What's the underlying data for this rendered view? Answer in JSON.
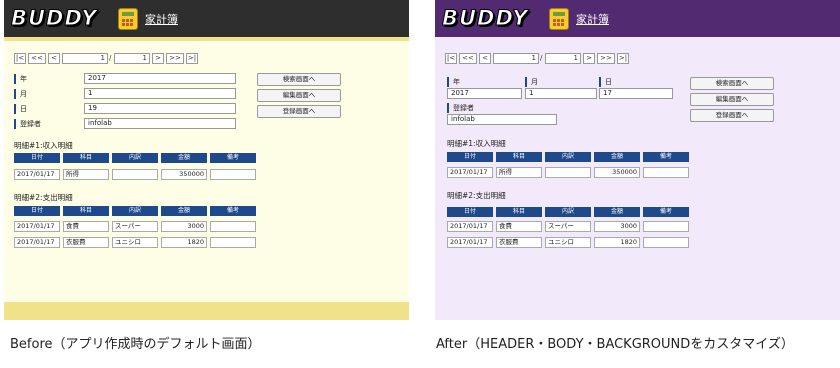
{
  "before": {
    "logo": "BUDDY",
    "app_title": "家計簿",
    "pager": {
      "first": "|<",
      "prev10": "<<",
      "prev": "<",
      "current": "1",
      "sep": "/",
      "total": "1",
      "next": ">",
      "next10": ">>",
      "last": ">|"
    },
    "fields": {
      "year_label": "年",
      "year_value": "2017",
      "month_label": "月",
      "month_value": "1",
      "day_label": "日",
      "day_value": "19",
      "registrant_label": "登録者",
      "registrant_value": "infolab"
    },
    "nav_buttons": [
      "検索画面へ",
      "編集画面へ",
      "登録画面へ"
    ],
    "section1": {
      "title": "明細#1:収入明細",
      "headers": [
        "日付",
        "科目",
        "内訳",
        "金額",
        "備考"
      ],
      "rows": [
        [
          "2017/01/17",
          "所得",
          "",
          "350000",
          ""
        ]
      ]
    },
    "section2": {
      "title": "明細#2:支出明細",
      "headers": [
        "日付",
        "科目",
        "内訳",
        "金額",
        "備考"
      ],
      "rows": [
        [
          "2017/01/17",
          "食費",
          "スーパー",
          "3000",
          ""
        ],
        [
          "2017/01/17",
          "衣服費",
          "ユニシロ",
          "1820",
          ""
        ]
      ]
    },
    "caption": "Before（アプリ作成時のデフォルト画面）"
  },
  "after": {
    "logo": "BUDDY",
    "app_title": "家計簿",
    "pager": {
      "first": "|<",
      "prev10": "<<",
      "prev": "<",
      "current": "1",
      "sep": "/",
      "total": "1",
      "next": ">",
      "next10": ">>",
      "last": ">|"
    },
    "fields": {
      "year_label": "年",
      "year_value": "2017",
      "month_label": "月",
      "month_value": "1",
      "day_label": "日",
      "day_value": "17",
      "registrant_label": "登録者",
      "registrant_value": "infolab"
    },
    "nav_buttons": [
      "検索画面へ",
      "編集画面へ",
      "登録画面へ"
    ],
    "section1": {
      "title": "明細#1:収入明細",
      "headers": [
        "日付",
        "科目",
        "内訳",
        "金額",
        "備考"
      ],
      "rows": [
        [
          "2017/01/17",
          "所得",
          "",
          "350000",
          ""
        ]
      ]
    },
    "section2": {
      "title": "明細#2:支出明細",
      "headers": [
        "日付",
        "科目",
        "内訳",
        "金額",
        "備考"
      ],
      "rows": [
        [
          "2017/01/17",
          "食費",
          "スーパー",
          "3000",
          ""
        ],
        [
          "2017/01/17",
          "衣服費",
          "ユニシロ",
          "1820",
          ""
        ]
      ]
    },
    "caption": "After（HEADER・BODY・BACKGROUNDをカスタマイズ）"
  },
  "colors": {
    "before_header": "#2e2e2e",
    "after_header": "#522a72",
    "before_body": "#fefde6",
    "after_body": "#f2eafb",
    "accent_stripe": "#f0e28a",
    "table_header": "#1e4a8c"
  }
}
